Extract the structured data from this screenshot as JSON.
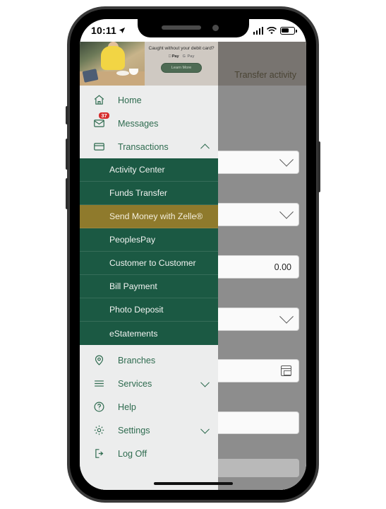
{
  "status_bar": {
    "time": "10:11",
    "location_icon": "location-arrow-icon",
    "signal_icon": "cellular-signal-icon",
    "wifi_icon": "wifi-icon",
    "battery_icon": "battery-icon"
  },
  "ad_banner": {
    "headline": "Caught without your debit card?",
    "apple_pay_label": "Pay",
    "google_pay_label": "Pay",
    "cta_label": "Learn More"
  },
  "drawer": {
    "items": [
      {
        "label": "Home",
        "icon": "home-icon",
        "badge": null,
        "chevron": null
      },
      {
        "label": "Messages",
        "icon": "envelope-icon",
        "badge": "37",
        "chevron": null
      },
      {
        "label": "Transactions",
        "icon": "credit-card-icon",
        "badge": null,
        "chevron": "chevron-up-icon",
        "expanded": true
      }
    ],
    "transactions_submenu": [
      {
        "label": "Activity Center",
        "active": false
      },
      {
        "label": "Funds Transfer",
        "active": false
      },
      {
        "label": "Send Money with Zelle®",
        "active": true
      },
      {
        "label": "PeoplesPay",
        "active": false
      },
      {
        "label": "Customer to Customer",
        "active": false
      },
      {
        "label": "Bill Payment",
        "active": false
      },
      {
        "label": "Photo Deposit",
        "active": false
      },
      {
        "label": "eStatements",
        "active": false
      }
    ],
    "bottom_items": [
      {
        "label": "Branches",
        "icon": "location-pin-icon",
        "chevron": null
      },
      {
        "label": "Services",
        "icon": "hamburger-menu-icon",
        "chevron": "chevron-down-icon"
      },
      {
        "label": "Help",
        "icon": "question-circle-icon",
        "chevron": null
      },
      {
        "label": "Settings",
        "icon": "gear-icon",
        "chevron": "chevron-down-icon"
      },
      {
        "label": "Log Off",
        "icon": "logout-icon",
        "chevron": null
      }
    ]
  },
  "background_page": {
    "title": "Transfer activity",
    "amount_value": "0.00",
    "from_dropdown_icon": "chevron-down-icon",
    "to_dropdown_icon": "chevron-down-icon",
    "frequency_dropdown_icon": "chevron-down-icon",
    "date_icon": "calendar-icon"
  },
  "colors": {
    "brand_green": "#2e6b4f",
    "submenu_green": "#1b5943",
    "active_gold": "#8f7a2c",
    "badge_red": "#d62b2b",
    "drawer_bg": "#eceded"
  }
}
